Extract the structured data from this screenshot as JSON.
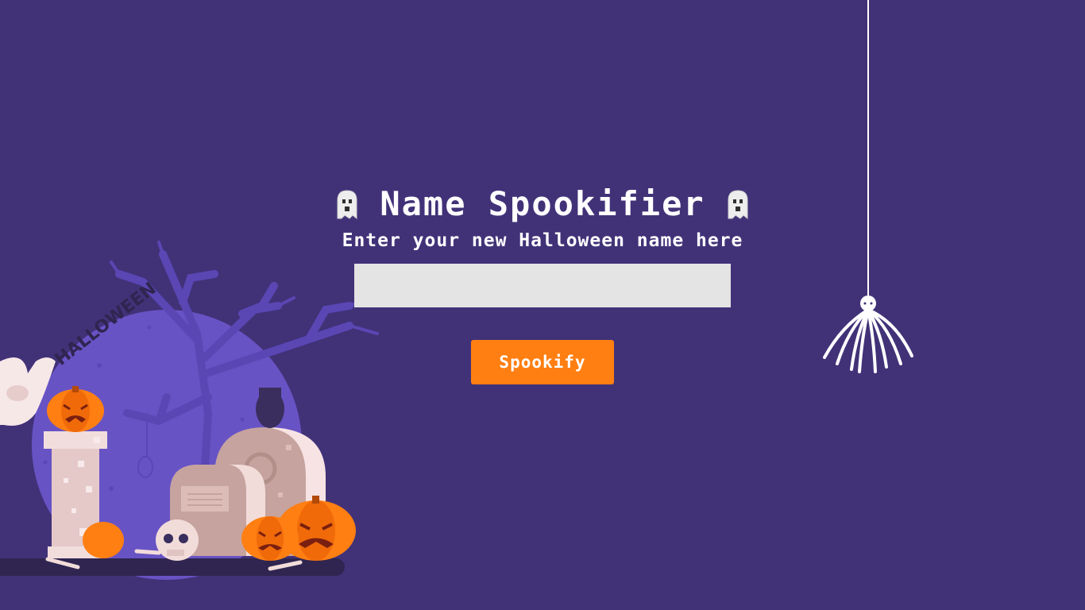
{
  "header": {
    "title": "Name Spookifier",
    "subtitle": "Enter your new Halloween name here"
  },
  "form": {
    "input_value": "",
    "button_label": "Spookify"
  },
  "colors": {
    "background": "#413278",
    "button": "#ff7f12",
    "input": "#e4e4e4",
    "text": "#ffffff"
  },
  "icons": {
    "left_title_icon": "ghost-icon",
    "right_title_icon": "ghost-icon"
  }
}
